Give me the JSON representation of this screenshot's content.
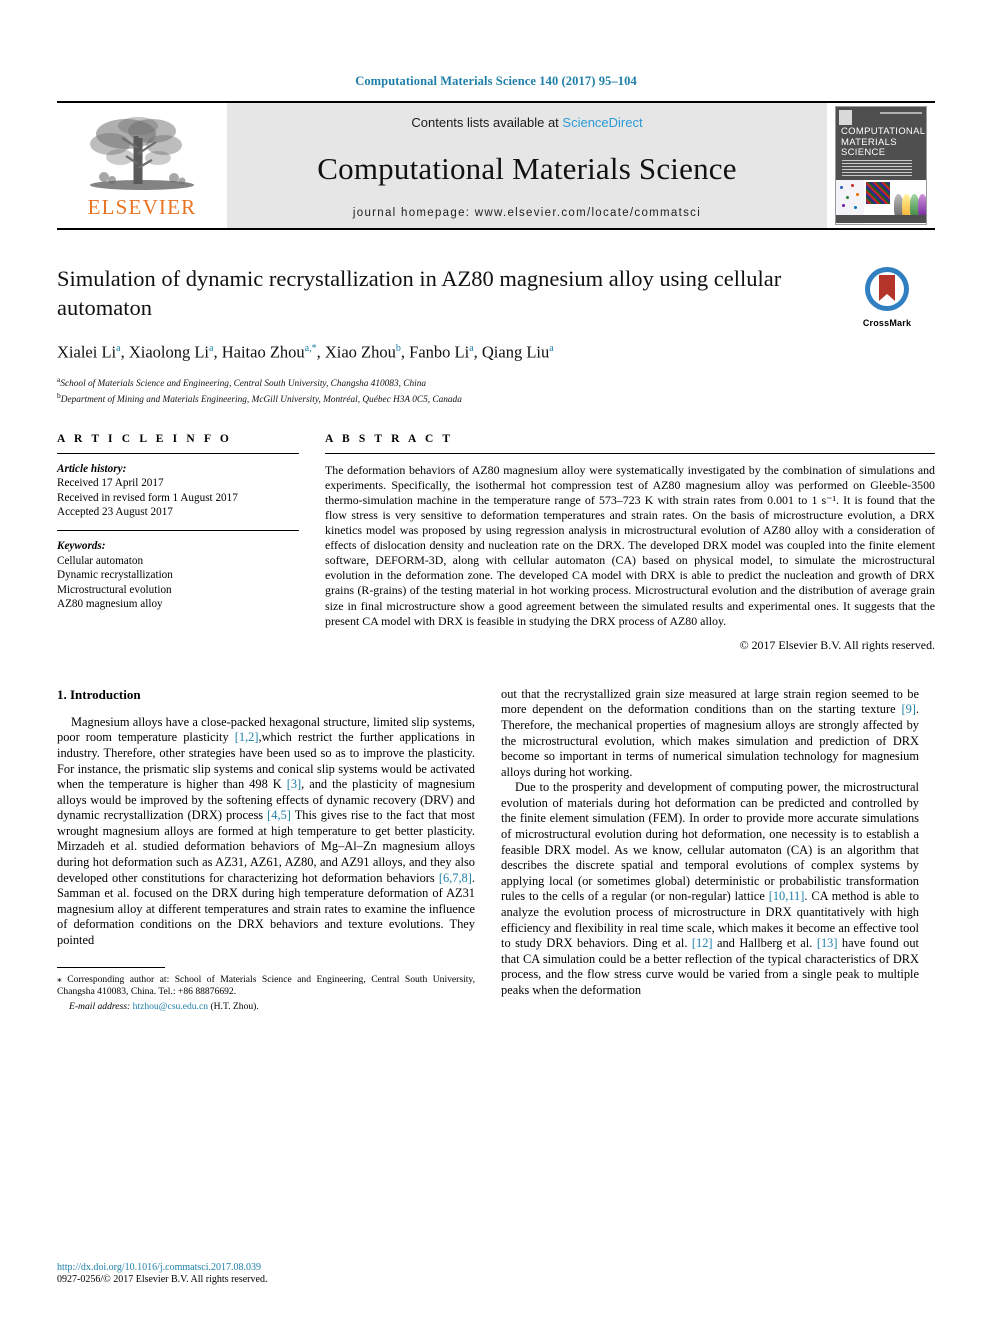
{
  "running_head": "Computational Materials Science 140 (2017) 95–104",
  "masthead": {
    "publisher": "ELSEVIER",
    "contents_prefix": "Contents lists available at ",
    "contents_link": "ScienceDirect",
    "journal_title": "Computational Materials Science",
    "homepage": "journal homepage: www.elsevier.com/locate/commatsci",
    "cover_title": "COMPUTATIONAL MATERIALS SCIENCE"
  },
  "article": {
    "title": "Simulation of dynamic recrystallization in AZ80 magnesium alloy using cellular automaton",
    "authors": "Xialei Li a, Xiaolong Li a, Haitao Zhou a,*, Xiao Zhou b, Fanbo Li a, Qiang Liu a",
    "affiliation_a": "School of Materials Science and Engineering, Central South University, Changsha 410083, China",
    "affiliation_b": "Department of Mining and Materials Engineering, McGill University, Montréal, Québec H3A 0C5, Canada",
    "crossmark_label": "CrossMark"
  },
  "info": {
    "heading": "A R T I C L E   I N F O",
    "history_label": "Article history:",
    "history": [
      "Received 17 April 2017",
      "Received in revised form 1 August 2017",
      "Accepted 23 August 2017"
    ],
    "keywords_label": "Keywords:",
    "keywords": [
      "Cellular automaton",
      "Dynamic recrystallization",
      "Microstructural evolution",
      "AZ80 magnesium alloy"
    ]
  },
  "abstract": {
    "heading": "A B S T R A C T",
    "text": "The deformation behaviors of AZ80 magnesium alloy were systematically investigated by the combination of simulations and experiments. Specifically, the isothermal hot compression test of AZ80 magnesium alloy was performed on Gleeble-3500 thermo-simulation machine in the temperature range of 573–723 K with strain rates from 0.001 to 1 s⁻¹. It is found that the flow stress is very sensitive to deformation temperatures and strain rates. On the basis of microstructure evolution, a DRX kinetics model was proposed by using regression analysis in microstructural evolution of AZ80 alloy with a consideration of effects of dislocation density and nucleation rate on the DRX. The developed DRX model was coupled into the finite element software, DEFORM-3D, along with cellular automaton (CA) based on physical model, to simulate the microstructural evolution in the deformation zone. The developed CA model with DRX is able to predict the nucleation and growth of DRX grains (R-grains) of the testing material in hot working process. Microstructural evolution and the distribution of average grain size in final microstructure show a good agreement between the simulated results and experimental ones. It suggests that the present CA model with DRX is feasible in studying the DRX process of AZ80 alloy.",
    "copyright": "© 2017 Elsevier B.V. All rights reserved."
  },
  "intro": {
    "heading": "1. Introduction",
    "left_p1_a": "Magnesium alloys have a close-packed hexagonal structure, limited slip systems, poor room temperature plasticity ",
    "left_p1_ref1": "[1,2]",
    "left_p1_b": ",which restrict the further applications in industry. Therefore, other strategies have been used so as to improve the plasticity. For instance, the prismatic slip systems and conical slip systems would be activated when the temperature is higher than 498 K ",
    "left_p1_ref2": "[3]",
    "left_p1_c": ", and the plasticity of magnesium alloys would be improved by the softening effects of dynamic recovery (DRV) and dynamic recrystallization (DRX) process ",
    "left_p1_ref3": "[4,5]",
    "left_p1_d": " This gives rise to the fact that most wrought magnesium alloys are formed at high temperature to get better plasticity. Mirzadeh et al. studied deformation behaviors of Mg–Al–Zn magnesium alloys during hot deformation such as AZ31, AZ61, AZ80, and AZ91 alloys, and they also developed other constitutions for characterizing hot deformation behaviors ",
    "left_p1_ref4": "[6,7,8]",
    "left_p1_e": ". Samman et al. focused on the DRX during high temperature deformation of AZ31 magnesium alloy at different temperatures and strain rates to examine the influence of deformation conditions on the DRX behaviors and texture evolutions. They pointed",
    "right_p1_a": "out that the recrystallized grain size measured at large strain region seemed to be more dependent on the deformation conditions than on the starting texture ",
    "right_p1_ref1": "[9]",
    "right_p1_b": ". Therefore, the mechanical properties of magnesium alloys are strongly affected by the microstructural evolution, which makes simulation and prediction of DRX become so important in terms of numerical simulation technology for magnesium alloys during hot working.",
    "right_p2_a": "Due to the prosperity and development of computing power, the microstructural evolution of materials during hot deformation can be predicted and controlled by the finite element simulation (FEM). In order to provide more accurate simulations of microstructural evolution during hot deformation, one necessity is to establish a feasible DRX model. As we know, cellular automaton (CA) is an algorithm that describes the discrete spatial and temporal evolutions of complex systems by applying local (or sometimes global) deterministic or probabilistic transformation rules to the cells of a regular (or non-regular) lattice ",
    "right_p2_ref1": "[10,11]",
    "right_p2_b": ". CA method is able to analyze the evolution process of microstructure in DRX quantitatively with high efficiency and flexibility in real time scale, which makes it become an effective tool to study DRX behaviors. Ding et al. ",
    "right_p2_ref2": "[12]",
    "right_p2_c": " and Hallberg et al. ",
    "right_p2_ref3": "[13]",
    "right_p2_d": " have found out that CA simulation could be a better reflection of the typical characteristics of DRX process, and the flow stress curve would be varied from a single peak to multiple peaks when the deformation"
  },
  "footnote": {
    "star": "⁎",
    "corresponding": " Corresponding author at: School of Materials Science and Engineering, Central South University, Changsha 410083, China. Tel.: +86 88876692.",
    "email_label": "E-mail address:",
    "email": "htzhou@csu.edu.cn",
    "email_suffix": " (H.T. Zhou)."
  },
  "footer": {
    "doi": "http://dx.doi.org/10.1016/j.commatsci.2017.08.039",
    "issn": "0927-0256/© 2017 Elsevier B.V. All rights reserved."
  },
  "colors": {
    "link": "#1f7fa8",
    "elsevier_orange": "#e87422",
    "sciencedirect": "#2a9ad6",
    "masthead_bg": "#e6e6e6"
  }
}
